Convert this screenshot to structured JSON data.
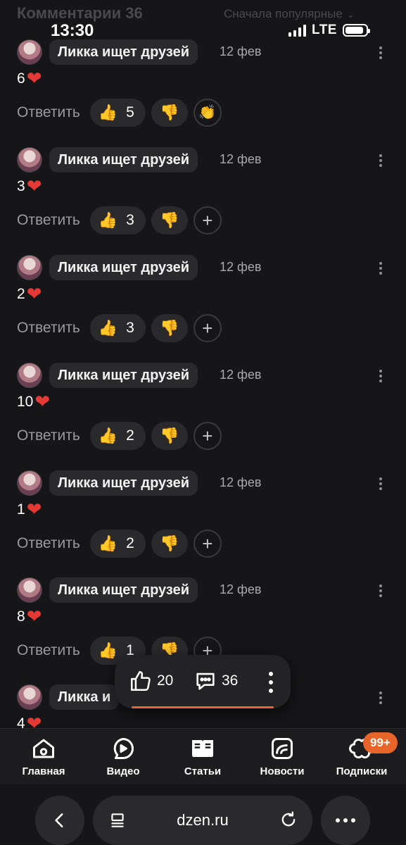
{
  "status_bar": {
    "time": "13:30",
    "network": "LTE"
  },
  "header": {
    "title": "Комментарии 36",
    "sort_label": "Сначала популярные"
  },
  "comments": [
    {
      "author": "Ликка ищет друзей",
      "date": "12 фев",
      "text": "6",
      "reply_label": "Ответить",
      "likes": "5",
      "extra": "clap"
    },
    {
      "author": "Ликка ищет друзей",
      "date": "12 фев",
      "text": "3",
      "reply_label": "Ответить",
      "likes": "3",
      "extra": "plus"
    },
    {
      "author": "Ликка ищет друзей",
      "date": "12 фев",
      "text": "2",
      "reply_label": "Ответить",
      "likes": "3",
      "extra": "plus"
    },
    {
      "author": "Ликка ищет друзей",
      "date": "12 фев",
      "text": "10",
      "reply_label": "Ответить",
      "likes": "2",
      "extra": "plus"
    },
    {
      "author": "Ликка ищет друзей",
      "date": "12 фев",
      "text": "1",
      "reply_label": "Ответить",
      "likes": "2",
      "extra": "plus"
    },
    {
      "author": "Ликка ищет друзей",
      "date": "12 фев",
      "text": "8",
      "reply_label": "Ответить",
      "likes": "1",
      "extra": "plus"
    },
    {
      "author": "Ликка и",
      "date": "",
      "text": "4",
      "reply_label": "",
      "likes": "",
      "extra": ""
    }
  ],
  "floating_bar": {
    "likes": "20",
    "comments": "36"
  },
  "bottom_nav": {
    "items": [
      {
        "label": "Главная",
        "icon": "home-icon"
      },
      {
        "label": "Видео",
        "icon": "video-icon"
      },
      {
        "label": "Статьи",
        "icon": "articles-icon"
      },
      {
        "label": "Новости",
        "icon": "news-icon"
      },
      {
        "label": "Подписки",
        "icon": "subscriptions-icon"
      }
    ],
    "badge": "99+"
  },
  "browser": {
    "host": "dzen.ru"
  },
  "colors": {
    "background": "#161618",
    "accent": "#e8652a",
    "pill": "#2a2a2d",
    "heart": "#e53935"
  }
}
